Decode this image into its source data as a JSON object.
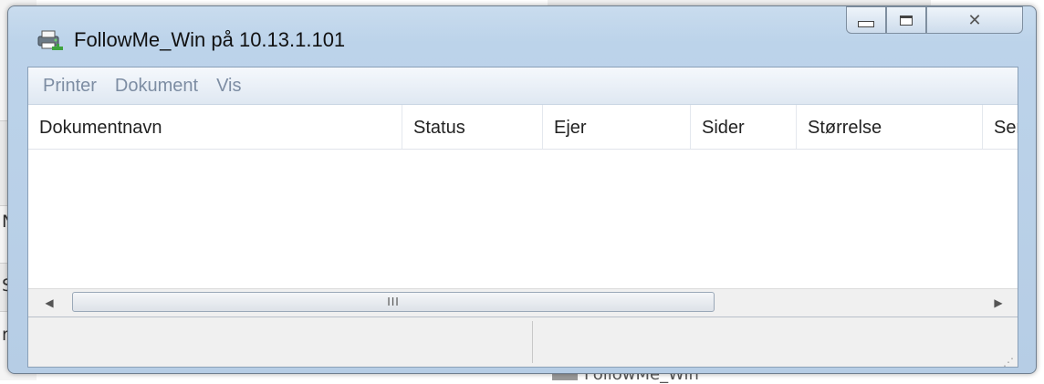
{
  "window": {
    "title": "FollowMe_Win på 10.13.1.101"
  },
  "menu": {
    "items": [
      "Printer",
      "Dokument",
      "Vis"
    ]
  },
  "columns": [
    "Dokumentnavn",
    "Status",
    "Ejer",
    "Sider",
    "Størrelse",
    "Ser"
  ],
  "rows": [],
  "scrollbar": {
    "grip": "III"
  },
  "background": {
    "left_letters": [
      "N",
      "S",
      "r"
    ],
    "bottom_text": "FollowMe_Win"
  },
  "colors": {
    "title_bar": "#bcd3ea",
    "menu_text": "#7d8da3",
    "border": "#6f7f90"
  }
}
